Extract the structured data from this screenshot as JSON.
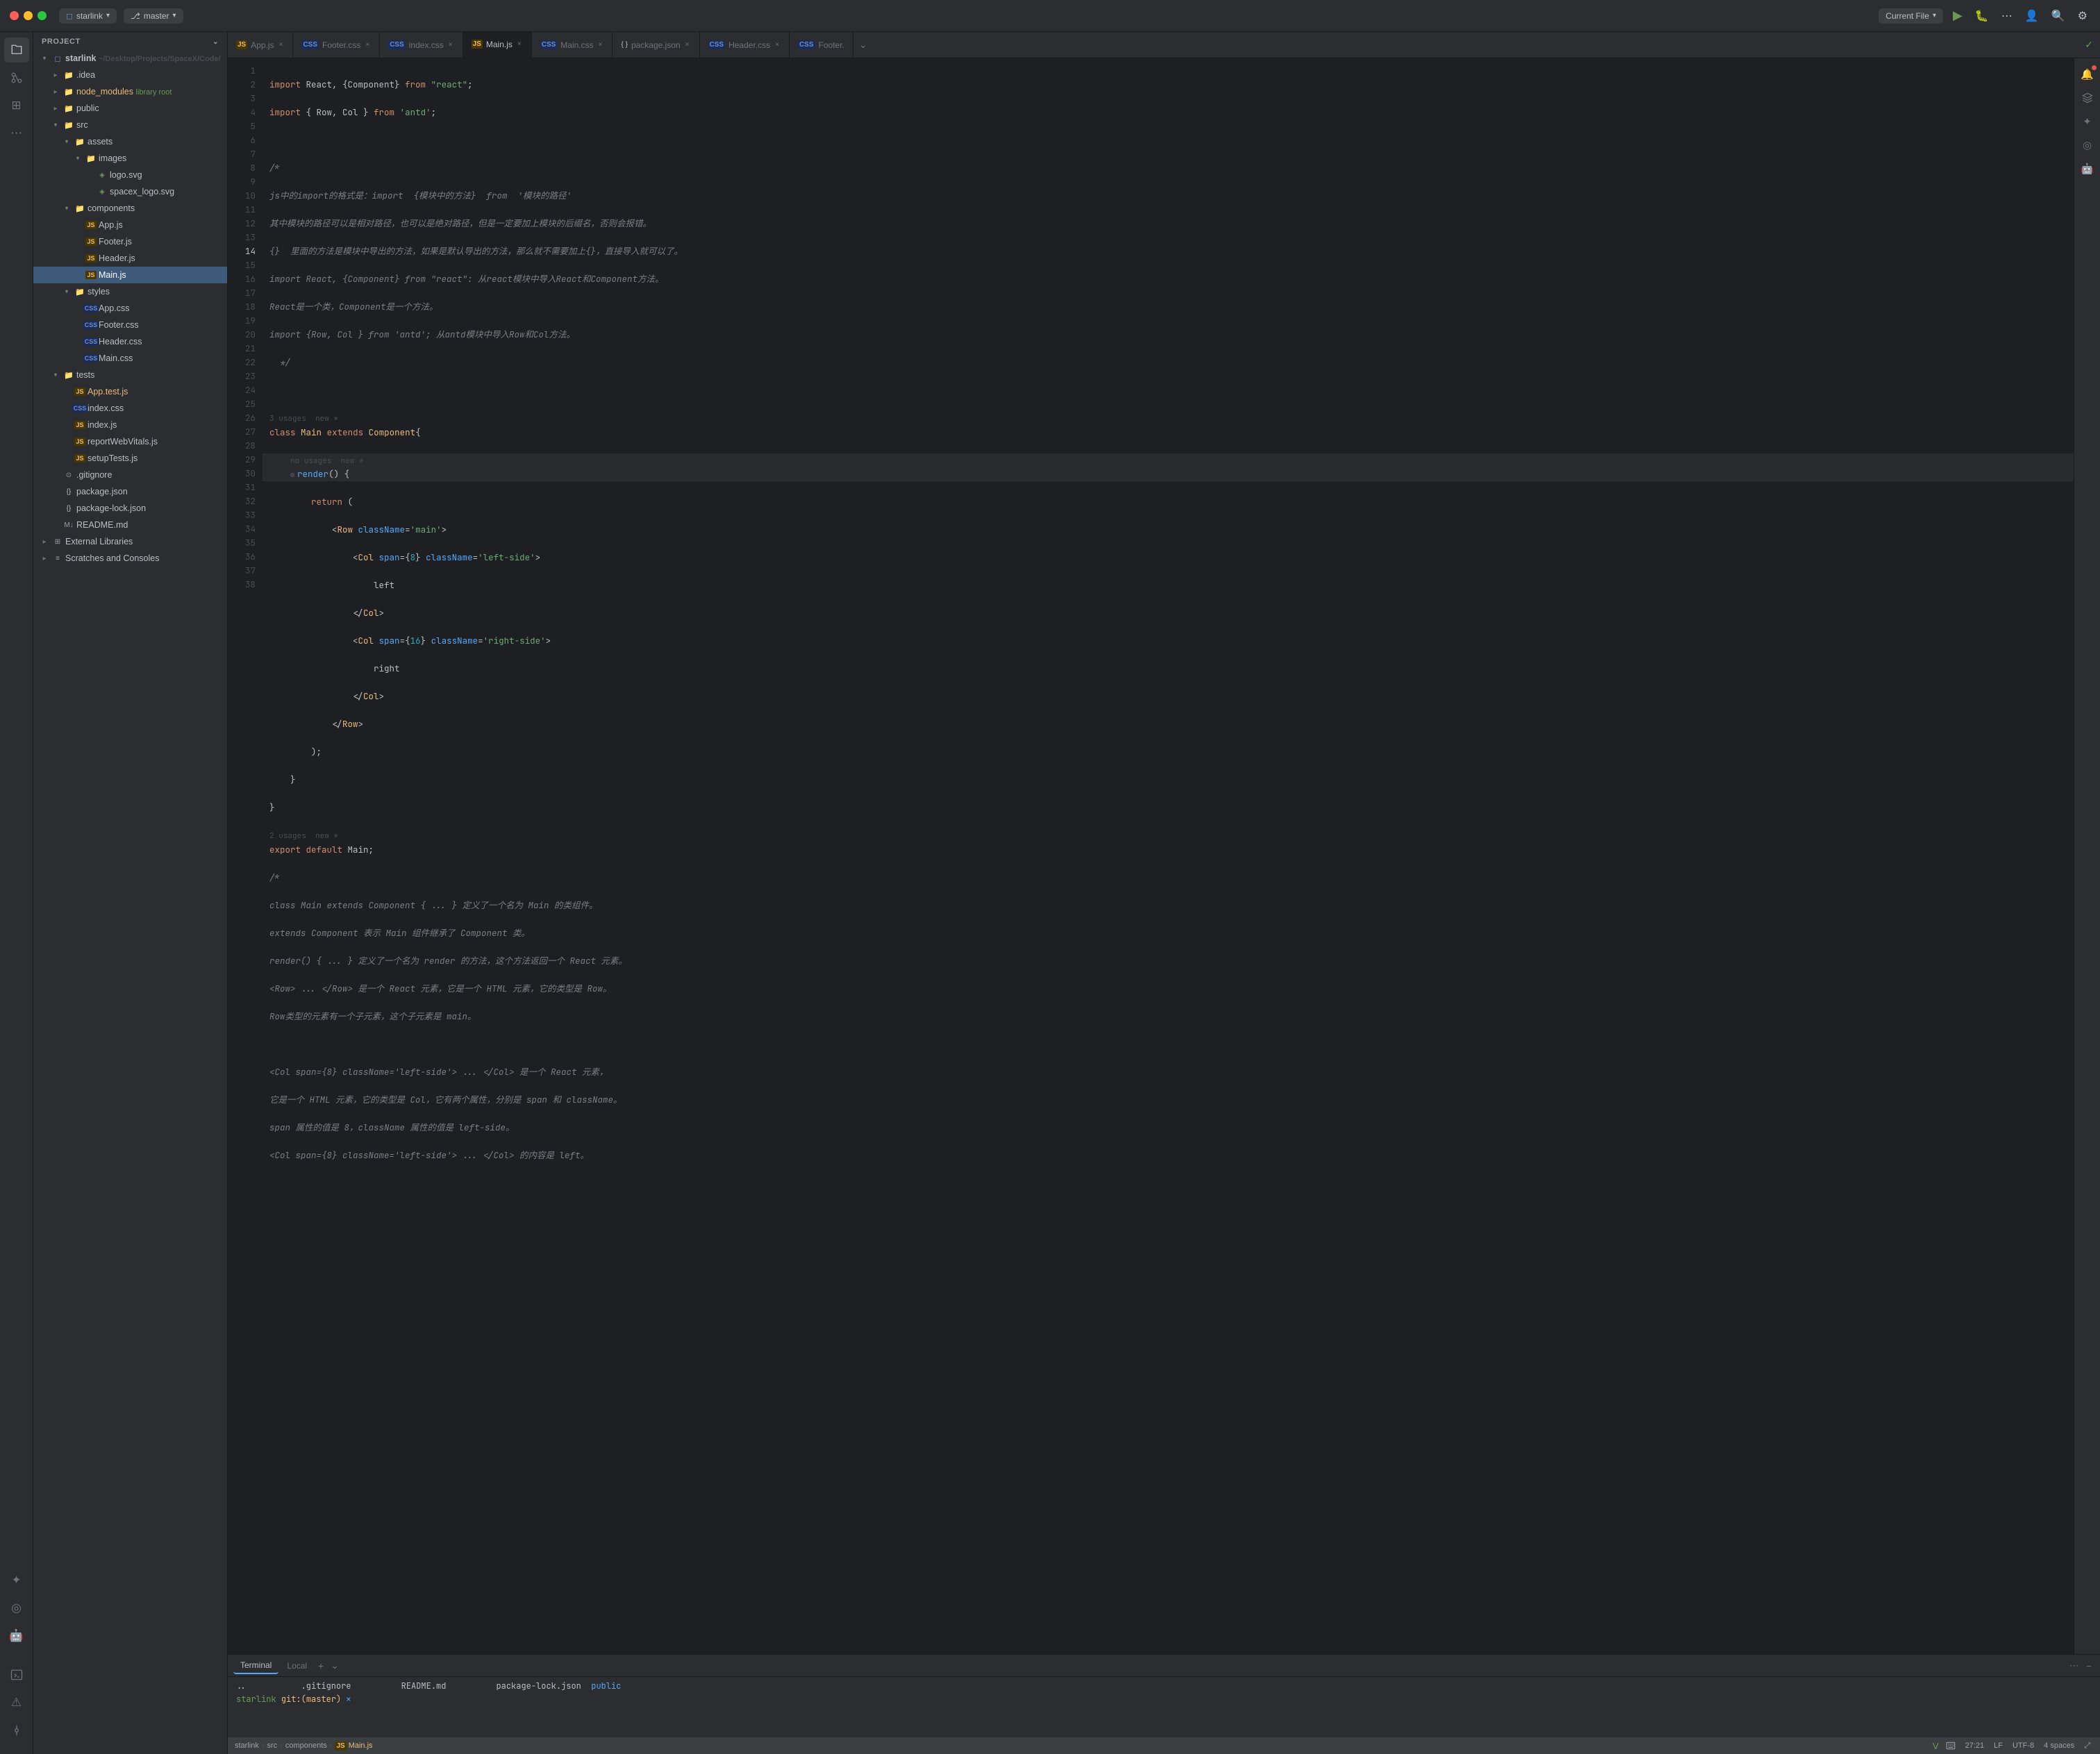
{
  "titlebar": {
    "project_label": "starlink",
    "branch_label": "master",
    "current_file_label": "Current File",
    "run_icon": "▶",
    "chevron": "⌄"
  },
  "tabs": [
    {
      "id": "app-js",
      "label": "App.js",
      "type": "js",
      "active": false,
      "closable": true
    },
    {
      "id": "footer-css",
      "label": "Footer.css",
      "type": "css",
      "active": false,
      "closable": true
    },
    {
      "id": "index-css",
      "label": "index.css",
      "type": "css",
      "active": false,
      "closable": true
    },
    {
      "id": "main-js",
      "label": "Main.js",
      "type": "js",
      "active": true,
      "closable": true
    },
    {
      "id": "main-css",
      "label": "Main.css",
      "type": "css",
      "active": false,
      "closable": true
    },
    {
      "id": "package-json",
      "label": "package.json",
      "type": "json",
      "active": false,
      "closable": true
    },
    {
      "id": "header-css",
      "label": "Header.css",
      "type": "css",
      "active": false,
      "closable": true
    },
    {
      "id": "footer2",
      "label": "Footer.",
      "type": "css",
      "active": false,
      "closable": false
    }
  ],
  "sidebar": {
    "header": "Project",
    "tree": [
      {
        "id": "starlink-root",
        "label": "starlink ~/Desktop/Projects/SpaceX/Code/",
        "type": "root",
        "indent": 0,
        "expanded": true
      },
      {
        "id": "idea",
        "label": ".idea",
        "type": "folder",
        "indent": 1,
        "expanded": false
      },
      {
        "id": "node-modules",
        "label": "node_modules",
        "type": "folder-special",
        "indent": 1,
        "expanded": false,
        "badge": "library root"
      },
      {
        "id": "public",
        "label": "public",
        "type": "folder",
        "indent": 1,
        "expanded": false
      },
      {
        "id": "src",
        "label": "src",
        "type": "folder",
        "indent": 1,
        "expanded": true
      },
      {
        "id": "assets",
        "label": "assets",
        "type": "folder",
        "indent": 2,
        "expanded": true
      },
      {
        "id": "images",
        "label": "images",
        "type": "folder",
        "indent": 3,
        "expanded": true
      },
      {
        "id": "logo-svg",
        "label": "logo.svg",
        "type": "svg",
        "indent": 4
      },
      {
        "id": "spacex-logo-svg",
        "label": "spacex_logo.svg",
        "type": "svg",
        "indent": 4
      },
      {
        "id": "components",
        "label": "components",
        "type": "folder",
        "indent": 2,
        "expanded": true
      },
      {
        "id": "app-js-file",
        "label": "App.js",
        "type": "js",
        "indent": 3
      },
      {
        "id": "footer-js-file",
        "label": "Footer.js",
        "type": "js",
        "indent": 3
      },
      {
        "id": "header-js-file",
        "label": "Header.js",
        "type": "js",
        "indent": 3
      },
      {
        "id": "main-js-file",
        "label": "Main.js",
        "type": "js",
        "indent": 3,
        "selected": true
      },
      {
        "id": "styles",
        "label": "styles",
        "type": "folder",
        "indent": 2,
        "expanded": true
      },
      {
        "id": "app-css-file",
        "label": "App.css",
        "type": "css",
        "indent": 3
      },
      {
        "id": "footer-css-file",
        "label": "Footer.css",
        "type": "css",
        "indent": 3
      },
      {
        "id": "header-css-file",
        "label": "Header.css",
        "type": "css",
        "indent": 3
      },
      {
        "id": "main-css-file",
        "label": "Main.css",
        "type": "css",
        "indent": 3
      },
      {
        "id": "tests",
        "label": "tests",
        "type": "folder",
        "indent": 1,
        "expanded": true
      },
      {
        "id": "app-test-js",
        "label": "App.test.js",
        "type": "test",
        "indent": 2
      },
      {
        "id": "index-css-file",
        "label": "index.css",
        "type": "css",
        "indent": 2
      },
      {
        "id": "index-js-file",
        "label": "index.js",
        "type": "js",
        "indent": 2
      },
      {
        "id": "report-web-vitals",
        "label": "reportWebVitals.js",
        "type": "js",
        "indent": 2
      },
      {
        "id": "setup-tests",
        "label": "setupTests.js",
        "type": "js",
        "indent": 2
      },
      {
        "id": "gitignore",
        "label": ".gitignore",
        "type": "config",
        "indent": 1
      },
      {
        "id": "package-json-file",
        "label": "package.json",
        "type": "json",
        "indent": 1
      },
      {
        "id": "package-lock-json",
        "label": "package-lock.json",
        "type": "json",
        "indent": 1
      },
      {
        "id": "readme",
        "label": "README.md",
        "type": "md",
        "indent": 1
      },
      {
        "id": "external-libraries",
        "label": "External Libraries",
        "type": "folder-system",
        "indent": 0,
        "expanded": false
      },
      {
        "id": "scratches",
        "label": "Scratches and Consoles",
        "type": "folder-system",
        "indent": 0,
        "expanded": false
      }
    ]
  },
  "code": {
    "lines": [
      {
        "num": 1,
        "content": "import React, {Component} from \"react\";"
      },
      {
        "num": 2,
        "content": "import { Row, Col } from 'antd';"
      },
      {
        "num": 3,
        "content": ""
      },
      {
        "num": 4,
        "content": "/*"
      },
      {
        "num": 5,
        "content": "js中的import的格式是：import  {模块中的方法}  from  '模块的路径'"
      },
      {
        "num": 6,
        "content": "其中模块的路径可以是相对路径，也可以是绝对路径，但是一定要加上模块的后缀名，否则会报错。"
      },
      {
        "num": 7,
        "content": "{}  里面的方法是模块中导出的方法，如果是默认导出的方法，那么就不需要加上{}，直接导入就可以了。"
      },
      {
        "num": 8,
        "content": "import React, {Component} from \"react\": 从react模块中导入React和Component方法。"
      },
      {
        "num": 9,
        "content": "React是一个类，Component是一个方法。"
      },
      {
        "num": 10,
        "content": "import {Row, Col } from 'antd'; 从antd模块中导入Row和Col方法。"
      },
      {
        "num": 11,
        "content": "  */"
      },
      {
        "num": 12,
        "content": ""
      },
      {
        "num": 13,
        "content": "class Main extends Component{",
        "hint": "3 usages  new *"
      },
      {
        "num": 14,
        "content": "    render() {",
        "hint": "no usages  new *",
        "method": true
      },
      {
        "num": 15,
        "content": "        return ("
      },
      {
        "num": 16,
        "content": "            <Row className='main'>"
      },
      {
        "num": 17,
        "content": "                <Col span={8} className='left-side'>"
      },
      {
        "num": 18,
        "content": "                    left"
      },
      {
        "num": 19,
        "content": "                </Col>"
      },
      {
        "num": 20,
        "content": "                <Col span={16} className='right-side'>"
      },
      {
        "num": 21,
        "content": "                    right"
      },
      {
        "num": 22,
        "content": "                </Col>"
      },
      {
        "num": 23,
        "content": "            </Row>"
      },
      {
        "num": 24,
        "content": "        );"
      },
      {
        "num": 25,
        "content": "    }"
      },
      {
        "num": 26,
        "content": "}"
      },
      {
        "num": 27,
        "content": "export default Main;",
        "hint": "2 usages  new *"
      },
      {
        "num": 28,
        "content": "/*"
      },
      {
        "num": 29,
        "content": "class Main extends Component { ... } 定义了一个名为 Main 的类组件。"
      },
      {
        "num": 30,
        "content": "extends Component 表示 Main 组件继承了 Component 类。"
      },
      {
        "num": 31,
        "content": "render() { ... } 定义了一个名为 render 的方法，这个方法返回一个 React 元素。"
      },
      {
        "num": 32,
        "content": "<Row> ... </Row> 是一个 React 元素，它是一个 HTML 元素，它的类型是 Row。"
      },
      {
        "num": 33,
        "content": "Row类型的元素有一个子元素，这个子元素是 main。"
      },
      {
        "num": 34,
        "content": ""
      },
      {
        "num": 35,
        "content": "<Col span={8} className='left-side'> ... </Col> 是一个 React 元素，"
      },
      {
        "num": 36,
        "content": "它是一个 HTML 元素，它的类型是 Col，它有两个属性，分别是 span 和 className。"
      },
      {
        "num": 37,
        "content": "span 属性的值是 8，className 属性的值是 left-side。"
      },
      {
        "num": 38,
        "content": "<Col span={8} className='left-side'> ... </Col> 的内容是 left。"
      }
    ]
  },
  "terminal": {
    "tabs": [
      {
        "label": "Terminal",
        "active": true
      },
      {
        "label": "Local",
        "active": false
      }
    ],
    "lines": [
      {
        "text": "..          .gitignore         README.md         package-lock.json  public"
      },
      {
        "text": "starlink git:(master) ✕",
        "type": "prompt"
      }
    ]
  },
  "statusbar": {
    "breadcrumb": [
      "starlink",
      "src",
      "components",
      "Main.js"
    ],
    "position": "27:21",
    "line_separator": "LF",
    "encoding": "UTF-8",
    "indent": "4 spaces"
  }
}
